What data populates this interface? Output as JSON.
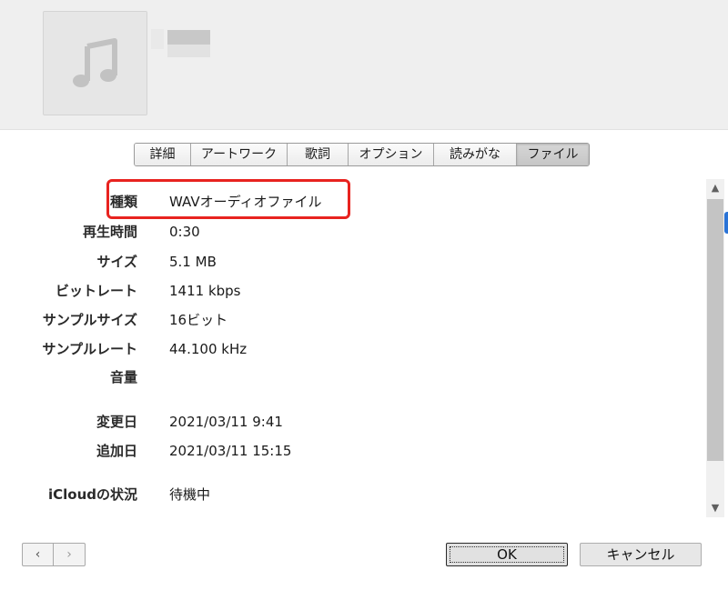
{
  "tabs": [
    {
      "label": "詳細"
    },
    {
      "label": "アートワーク"
    },
    {
      "label": "歌詞"
    },
    {
      "label": "オプション"
    },
    {
      "label": "読みがな"
    },
    {
      "label": "ファイル",
      "active": true
    }
  ],
  "info": {
    "kind": {
      "label": "種類",
      "value": "WAVオーディオファイル"
    },
    "duration": {
      "label": "再生時間",
      "value": "0:30"
    },
    "size": {
      "label": "サイズ",
      "value": "5.1 MB"
    },
    "bitrate": {
      "label": "ビットレート",
      "value": "1411 kbps"
    },
    "sample_size": {
      "label": "サンプルサイズ",
      "value": "16ビット"
    },
    "sample_rate": {
      "label": "サンプルレート",
      "value": "44.100 kHz"
    },
    "volume": {
      "label": "音量",
      "value": ""
    },
    "modified": {
      "label": "変更日",
      "value": "2021/03/11 9:41"
    },
    "added": {
      "label": "追加日",
      "value": "2021/03/11 15:15"
    },
    "icloud": {
      "label": "iCloudの状況",
      "value": "待機中"
    }
  },
  "buttons": {
    "ok": "OK",
    "cancel": "キャンセル",
    "prev": "‹",
    "next": "›"
  },
  "colors": {
    "highlight": "#e8231f",
    "accent": "#2a73d6"
  },
  "icons": {
    "artwork": "music-note-icon"
  }
}
